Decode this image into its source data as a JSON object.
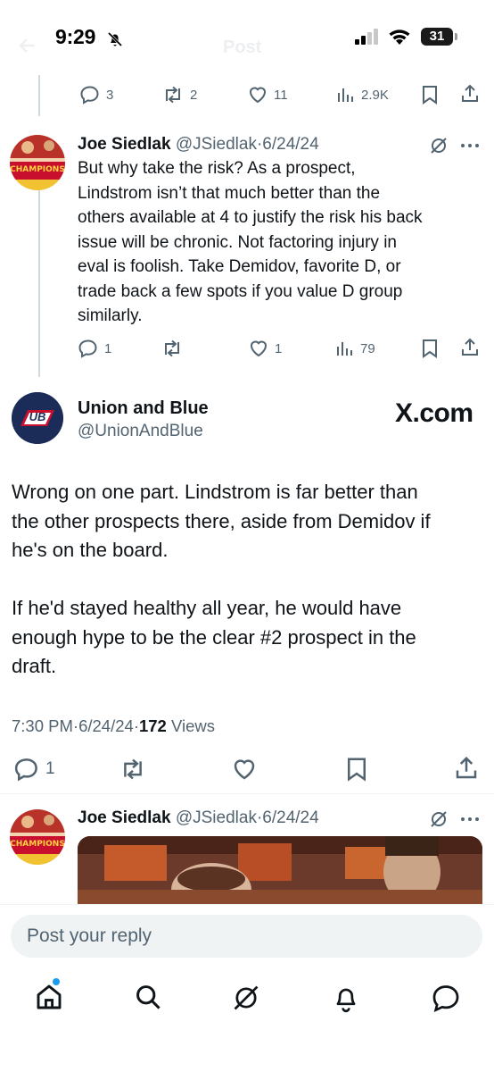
{
  "status_bar": {
    "time": "9:29",
    "battery": "31"
  },
  "header": {
    "title": "Post"
  },
  "prev_actions": {
    "replies": "3",
    "reposts": "2",
    "likes": "11",
    "views": "2.9K"
  },
  "reply1": {
    "name": "Joe Siedlak",
    "handle": "@JSiedlak",
    "dot": "·",
    "date": "6/24/24",
    "avatar_text": "CHAMPIONS",
    "lines": [
      "But why take the risk? As a prospect,",
      "Lindstrom isn’t that much better than the",
      "others available at 4 to justify the risk his back",
      "issue will be chronic. Not factoring injury in",
      "eval is foolish. Take Demidov, favorite D, or",
      "trade back a few spots if you value D group",
      "similarly."
    ],
    "actions": {
      "replies": "1",
      "reposts": "",
      "likes": "1",
      "views": "79"
    }
  },
  "main": {
    "name": "Union and Blue",
    "handle": "@UnionAndBlue",
    "avatar_text": "UB",
    "source": "X.com",
    "lines": [
      "Wrong on one part. Lindstrom is far better than",
      "the other prospects there, aside from Demidov if",
      "he's on the board.",
      "",
      "If he'd stayed healthy all year, he would have",
      "enough hype to be the clear #2 prospect in the",
      "draft."
    ],
    "time": "7:30 PM",
    "dot": "·",
    "date": "6/24/24",
    "views_count": "172",
    "views_label": "Views",
    "actions": {
      "replies": "1"
    }
  },
  "reply2": {
    "name": "Joe Siedlak",
    "handle": "@JSiedlak",
    "dot": "·",
    "date": "6/24/24",
    "avatar_text": "CHAMPIONS"
  },
  "compose": {
    "placeholder": "Post your reply"
  },
  "tabbar": {
    "items": [
      "home",
      "search",
      "grok",
      "notifications",
      "messages"
    ]
  },
  "colors": {
    "text": "#0f1419",
    "secondary": "#536471",
    "accent": "#1d9bf0",
    "divider": "#eff3f4"
  }
}
